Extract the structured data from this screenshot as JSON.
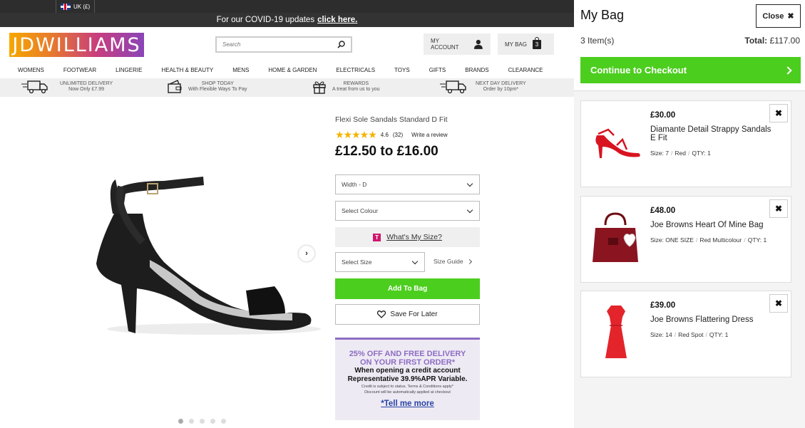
{
  "topbar": {
    "locale": "UK (£)"
  },
  "covid": {
    "text": "For our COVID-19 updates",
    "link": "click here."
  },
  "header": {
    "logo": "JDWILLIAMS",
    "search_placeholder": "Search",
    "account_label": "MY ACCOUNT",
    "bag_label": "MY BAG",
    "bag_count": "3"
  },
  "nav": [
    "WOMENS",
    "FOOTWEAR",
    "LINGERIE",
    "HEALTH & BEAUTY",
    "MENS",
    "HOME & GARDEN",
    "ELECTRICALS",
    "TOYS",
    "GIFTS",
    "BRANDS",
    "CLEARANCE"
  ],
  "usps": [
    {
      "title": "UNLIMITED DELIVERY",
      "sub": "Now Only £7.99",
      "icon": "truck-icon"
    },
    {
      "title": "SHOP TODAY",
      "sub": "With Flexible Ways To Pay",
      "icon": "wallet-icon"
    },
    {
      "title": "REWARDS",
      "sub": "A treat from us to you",
      "icon": "gift-icon"
    },
    {
      "title": "NEXT DAY DELIVERY",
      "sub": "Order by 10pm*",
      "icon": "truck-icon"
    }
  ],
  "product": {
    "title": "Flexi Sole Sandals Standard D Fit",
    "rating": "4.6",
    "reviews": "(32)",
    "write_review": "Write a review",
    "price": "£12.50 to £16.00",
    "width_select": "Width - D",
    "colour_select": "Select Colour",
    "whats_my_size_badge": "T",
    "whats_my_size": "What's My Size?",
    "size_select": "Select Size",
    "size_guide": "Size Guide",
    "add_to_bag": "Add To Bag",
    "save_for_later": "Save For Later"
  },
  "promo": {
    "headline1": "25% OFF AND FREE DELIVERY",
    "headline2": "ON YOUR FIRST ORDER*",
    "body1": "When opening a credit account",
    "body2": "Representative 39.9%APR Variable.",
    "small1": "Credit is subject to status. Terms & Conditions apply*",
    "small2": "Discount will be automatically applied at checkout",
    "link": "*Tell me more"
  },
  "bag": {
    "title": "My Bag",
    "close": "Close",
    "count": "3 Item(s)",
    "total_label": "Total:",
    "total_value": "£117.00",
    "checkout": "Continue to Checkout",
    "items": [
      {
        "price": "£30.00",
        "name": "Diamante Detail Strappy Sandals E Fit",
        "size": "Size: 7",
        "colour": "Red",
        "qty": "QTY: 1"
      },
      {
        "price": "£48.00",
        "name": "Joe Browns Heart Of Mine Bag",
        "size": "Size: ONE SIZE",
        "colour": "Red Multicolour",
        "qty": "QTY: 1"
      },
      {
        "price": "£39.00",
        "name": "Joe Browns Flattering Dress",
        "size": "Size: 14",
        "colour": "Red Spot",
        "qty": "QTY: 1"
      }
    ]
  },
  "colors": {
    "green": "#4cce1f",
    "promo_purple": "#8d6dc2",
    "star": "#f2b400",
    "link_blue": "#2a44a6"
  }
}
